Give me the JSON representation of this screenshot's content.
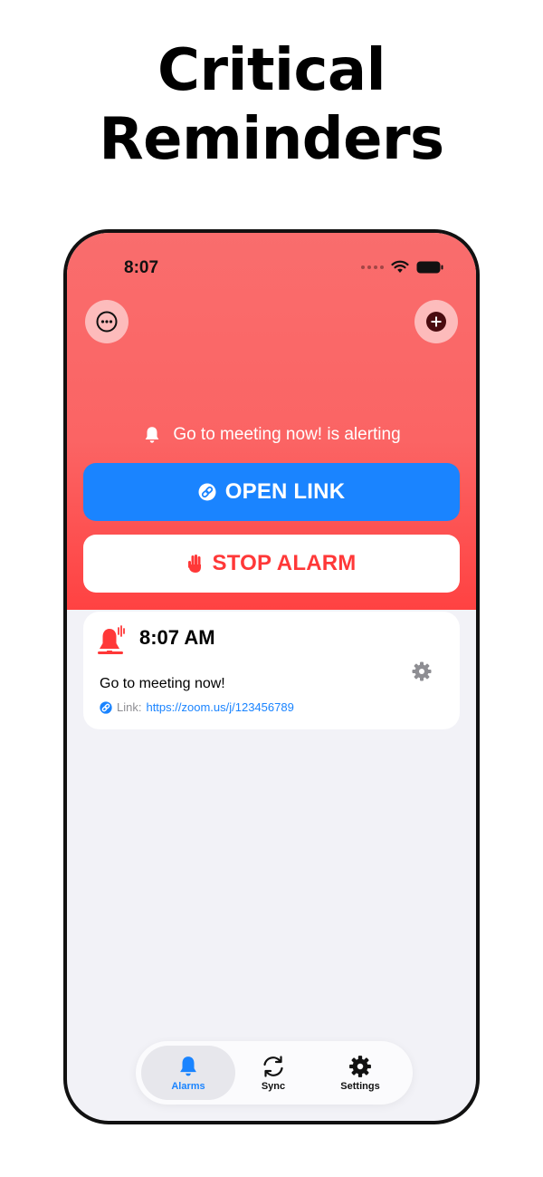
{
  "headline": {
    "line1": "Critical",
    "line2": "Reminders"
  },
  "status_bar": {
    "time": "8:07"
  },
  "header": {
    "more_icon": "ellipsis-circle-icon",
    "add_icon": "plus-circle-icon",
    "alert_text": "Go to meeting now! is alerting",
    "open_link_label": "OPEN LINK",
    "stop_alarm_label": "STOP ALARM"
  },
  "alarm_card": {
    "time": "8:07 AM",
    "title": "Go to meeting now!",
    "link_prefix": "Link:",
    "link_url": "https://zoom.us/j/123456789"
  },
  "tabs": [
    {
      "label": "Alarms",
      "icon": "bell-icon",
      "active": true
    },
    {
      "label": "Sync",
      "icon": "sync-icon",
      "active": false
    },
    {
      "label": "Settings",
      "icon": "gear-icon",
      "active": false
    }
  ],
  "colors": {
    "hero_red": "#fb6464",
    "accent_blue": "#1a84ff",
    "stop_red": "#ff3838",
    "background": "#f2f2f7"
  }
}
